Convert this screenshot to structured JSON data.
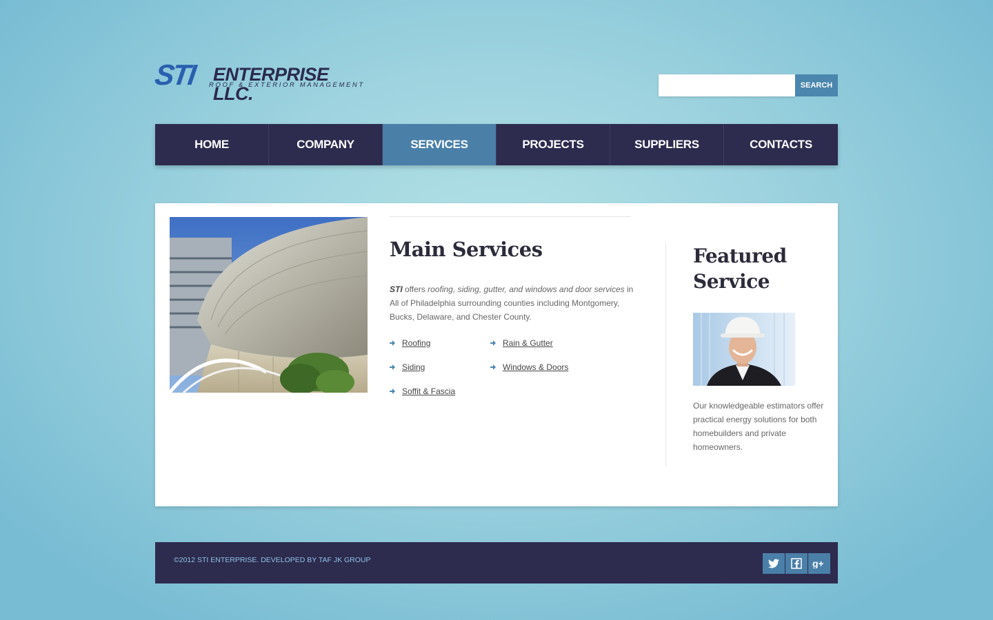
{
  "header": {
    "logo_mark": "STI",
    "logo_name": "ENTERPRISE LLC.",
    "logo_tagline": "ROOF & EXTERIOR MANAGEMENT",
    "search": {
      "placeholder": "",
      "value": "",
      "button_label": "SEARCH"
    }
  },
  "nav": {
    "items": [
      {
        "label": "HOME",
        "active": false
      },
      {
        "label": "COMPANY",
        "active": false
      },
      {
        "label": "SERVICES",
        "active": true
      },
      {
        "label": "PROJECTS",
        "active": false
      },
      {
        "label": "SUPPLIERS",
        "active": false
      },
      {
        "label": "CONTACTS",
        "active": false
      }
    ]
  },
  "main": {
    "title": "Main Services",
    "intro": {
      "brand": "STI",
      "text1": " offers ",
      "services_italic": "roofing, siding, gutter, and windows and door services",
      "text2": " in All of Philadelphia surrounding counties including Montgomery, Bucks, Delaware, and Chester County."
    },
    "services": [
      "Roofing",
      "Rain & Gutter",
      "Siding",
      "Windows & Doors",
      "Soffit & Fascia"
    ]
  },
  "featured": {
    "title": "Featured Service",
    "text": "Our knowledgeable estimators offer practical energy solutions for both homebuilders and private homeowners."
  },
  "footer": {
    "copyright": "©2012 STI ENTERPRISE. DEVELOPED BY TAF JK GROUP",
    "socials": [
      "twitter-icon",
      "facebook-icon",
      "google-plus-icon"
    ]
  },
  "colors": {
    "nav_bg": "#2d2b4e",
    "nav_active": "#4a7fa8",
    "accent": "#4a86ad"
  }
}
